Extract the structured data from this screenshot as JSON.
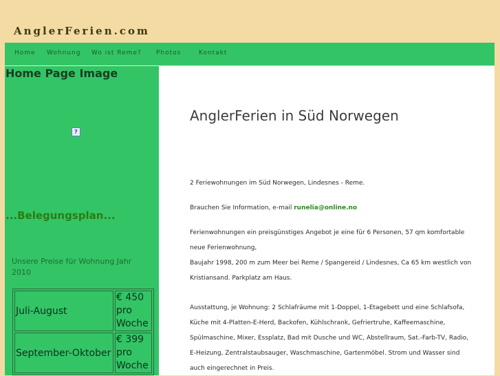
{
  "header": {
    "site_title": "AnglerFerien.com"
  },
  "nav": {
    "items": [
      {
        "label": "Home"
      },
      {
        "label": "Wohnung"
      },
      {
        "label": "Wo ist Reme?"
      },
      {
        "label": "Photos"
      },
      {
        "label": "Kontakt"
      }
    ]
  },
  "sidebar": {
    "heading": "Home Page Image",
    "broken_image_glyph": "?",
    "belegungsplan": "...Belegungsplan...",
    "preise_title": "Unsere Preise für Wohnung Jahr 2010",
    "prices": [
      {
        "period": "Juli-August",
        "price": "€ 450 pro Woche"
      },
      {
        "period": "September-Oktober",
        "price": "€ 399 pro Woche"
      }
    ]
  },
  "main": {
    "title": "AnglerFerien in Süd Norwegen",
    "p1": "2 Feriewohnungen im Süd Norwegen, Lindesnes - Reme.",
    "p2_prefix": "Brauchen Sie Information, e-mail",
    "email": "runelia@online.no",
    "p3a": "Ferienwohnungen ein preisgünstiges Angebot je eine für 6 Personen, 57 qm komfortable neue Ferienwohnung,",
    "p3b": "Baujahr 1998, 200 m zum Meer bei Reme / Spangereid / Lindesnes, Ca 65 km westlich von Kristiansand. Parkplatz am Haus.",
    "p4": "Ausstattung, je Wohnung: 2 Schlafräume mit 1-Doppel, 1-Etagebett und eine Schlafsofa, Küche mit 4-Platten-E-Herd, Backofen, Kühlschrank, Gefriertruhe, Kaffeemaschine, Spülmaschine, Mixer, Essplatz, Bad mit Dusche und WC, Abstellraum, Sat.-Farb-TV, Radio, E-Heizung, Zentralstaubsauger, Waschmaschine, Gartenmöbel. Strom und Wasser sind auch eingerechnet in Preis."
  }
}
